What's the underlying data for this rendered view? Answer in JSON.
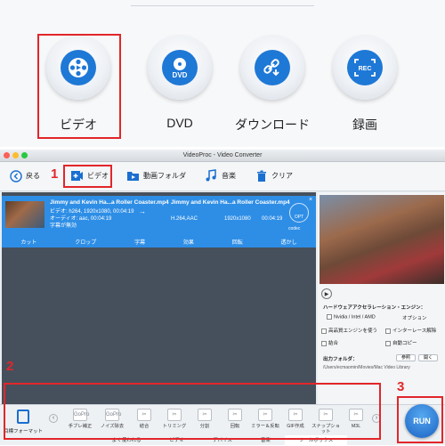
{
  "launcher": {
    "modules": [
      {
        "label": "ビデオ",
        "icon": "film-reel-icon"
      },
      {
        "label": "DVD",
        "icon": "dvd-disc-icon",
        "badge": "DVD"
      },
      {
        "label": "ダウンロード",
        "icon": "download-link-icon"
      },
      {
        "label": "録画",
        "icon": "record-screen-icon",
        "badge": "REC"
      }
    ]
  },
  "annotations": {
    "n1": "1",
    "n2": "2",
    "n3": "3",
    "color": "#e2262a"
  },
  "window": {
    "title": "VideoProc - Video Converter"
  },
  "toolbar": {
    "back": "戻る",
    "video": "ビデオ",
    "folder": "動画フォルダ",
    "music": "音楽",
    "clear": "クリア"
  },
  "item": {
    "source_name": "Jimmy and Kevin Ha...a Roller Coaster.mp4",
    "video_info": "ビデオ: h264, 1920x1080, 00:04:19",
    "audio_info": "オーディオ: aac, 00:04:19",
    "subtitle_info": "字幕が無効",
    "output_name": "Jimmy and Kevin Ha...a Roller Coaster.mp4",
    "out_codec": "H.264,AAC",
    "out_res": "1920x1080",
    "out_dur": "00:04:19",
    "codec_label": "codec",
    "opt_label": "OPT",
    "edit_actions": [
      "カット",
      "クロップ",
      "字幕",
      "効果",
      "回転",
      "透かし"
    ]
  },
  "right_panel": {
    "hw_title": "ハードウェアアクセラレーション・エンジン：",
    "nvidia": "Nvidia / Intel / AMD",
    "option": "オプション",
    "hq_engine": "高品質エンジンを使う",
    "deinterlace": "インターレース解除",
    "merge": "結合",
    "auto_copy": "自動コピー",
    "out_folder_label": "出力フォルダ：",
    "browse": "参照",
    "open": "開く",
    "out_path": "/Users/ecmaomin/Movies/Mac Video Library"
  },
  "bottom": {
    "target_format": "目標フォーマット",
    "tools": [
      {
        "label": "手ブレ補正",
        "badge": "GoPro"
      },
      {
        "label": "ノイズ除去",
        "badge": "GoPro"
      },
      {
        "label": "結合"
      },
      {
        "label": "トリミング"
      },
      {
        "label": "分割"
      },
      {
        "label": "回転"
      },
      {
        "label": "ミラー＆反転"
      },
      {
        "label": "GIF作成"
      },
      {
        "label": "スナップショット"
      },
      {
        "label": "M3L"
      }
    ],
    "tabs": [
      "よく使われる",
      "ビデオ",
      "デバイス",
      "音楽",
      "ツールボックス"
    ],
    "active_tab": "ツールボックス",
    "run": "RUN"
  }
}
